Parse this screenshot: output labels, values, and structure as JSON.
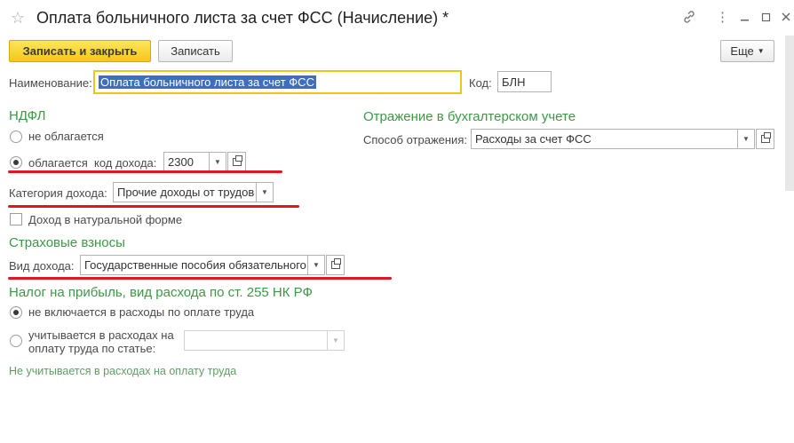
{
  "window": {
    "title": "Оплата больничного листа за счет ФСС (Начисление) *",
    "icons": [
      "star-icon",
      "link-icon",
      "more-vertical-icon",
      "minimize-icon",
      "maximize-icon",
      "close-icon"
    ]
  },
  "toolbar": {
    "save_close_label": "Записать и закрыть",
    "save_label": "Записать",
    "more_label": "Еще"
  },
  "header": {
    "name_label": "Наименование:",
    "name_value": "Оплата больничного листа за счет ФСС",
    "code_label": "Код:",
    "code_value": "БЛН"
  },
  "ndfl": {
    "title": "НДФЛ",
    "option_not_taxed": "не облагается",
    "option_taxed": "облагается",
    "selected": "облагается",
    "income_code_label": "код дохода:",
    "income_code_value": "2300",
    "category_label": "Категория дохода:",
    "category_value": "Прочие доходы от трудов",
    "natural_form_label": "Доход в натуральной форме",
    "natural_form_checked": false
  },
  "insurance": {
    "title": "Страховые взносы",
    "income_type_label": "Вид дохода:",
    "income_type_value": "Государственные пособия обязательного"
  },
  "profit_tax": {
    "title": "Налог на прибыль, вид расхода по ст. 255 НК РФ",
    "option_not_included": "не включается в расходы по оплате труда",
    "option_included_line1": "учитывается в расходах на",
    "option_included_line2": "оплату труда по статье:",
    "selected": "не включается в расходы по оплате труда",
    "article_value": "",
    "note": "Не учитывается в расходах на оплату труда"
  },
  "accounting": {
    "title": "Отражение в бухгалтерском учете",
    "method_label": "Способ отражения:",
    "method_value": "Расходы за счет ФСС"
  },
  "colors": {
    "section_title": "#3b9a46",
    "primary_button": "#f5c718",
    "focus_border": "#f0c419",
    "selection": "#3d6fbf",
    "annotation_underline": "#e0171f"
  }
}
